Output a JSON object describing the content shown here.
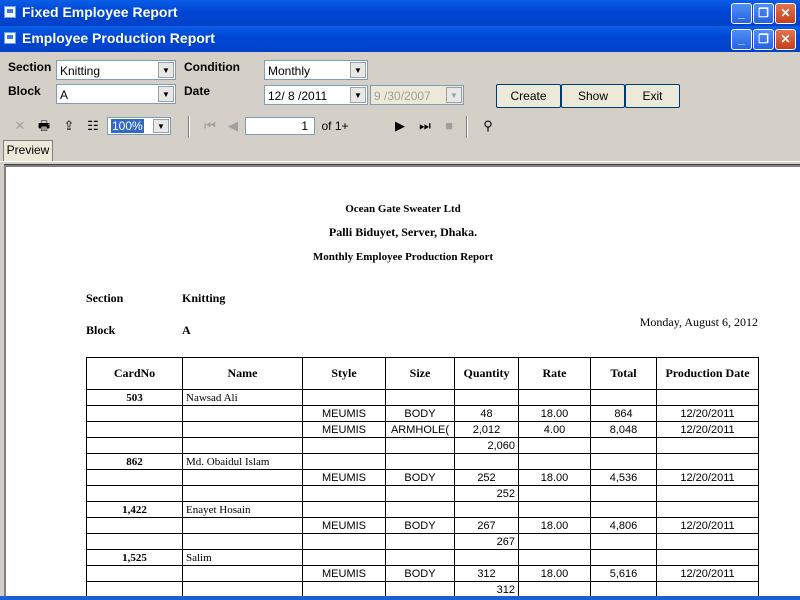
{
  "outer_window": {
    "title": "Fixed Employee Report"
  },
  "inner_window": {
    "title": "Employee Production Report"
  },
  "filters": {
    "section_label": "Section",
    "section_value": "Knitting",
    "block_label": "Block",
    "block_value": "A",
    "condition_label": "Condition",
    "condition_value": "Monthly",
    "date_label": "Date",
    "date_from": "12/ 8 /2011",
    "date_to": "9 /30/2007"
  },
  "buttons": {
    "create": "Create",
    "show": "Show",
    "exit": "Exit"
  },
  "toolbar": {
    "zoom": "100%",
    "page_number": "1",
    "page_of": "of 1+",
    "close_icon": "x-icon",
    "print_icon": "printer-icon",
    "export_icon": "export-icon",
    "tree_icon": "group-tree-icon",
    "first_icon": "first-page-icon",
    "prev_icon": "prev-page-icon",
    "next_icon": "next-page-icon",
    "last_icon": "last-page-icon",
    "stop_icon": "stop-icon",
    "search_icon": "binoculars-icon"
  },
  "tabs": {
    "preview": "Preview"
  },
  "report": {
    "company": "Ocean Gate Sweater Ltd",
    "address": "Palli Biduyet, Server, Dhaka.",
    "title": "Monthly Employee Production Report",
    "section_label": "Section",
    "section_value": "Knitting",
    "block_label": "Block",
    "block_value": "A",
    "print_date": "Monday, August 6, 2012",
    "columns": [
      "CardNo",
      "Name",
      "Style",
      "Size",
      "Quantity",
      "Rate",
      "Total",
      "Production Date"
    ],
    "employees": [
      {
        "card": "503",
        "name": "Nawsad Ali",
        "rows": [
          {
            "style": "MEUMIS",
            "size": "BODY",
            "qty": "48",
            "rate": "18.00",
            "total": "864",
            "date": "12/20/2011"
          },
          {
            "style": "MEUMIS",
            "size": "ARMHOLE(",
            "qty": "2,012",
            "rate": "4.00",
            "total": "8,048",
            "date": "12/20/2011"
          }
        ],
        "subtotal": "2,060"
      },
      {
        "card": "862",
        "name": "Md. Obaidul Islam",
        "rows": [
          {
            "style": "MEUMIS",
            "size": "BODY",
            "qty": "252",
            "rate": "18.00",
            "total": "4,536",
            "date": "12/20/2011"
          }
        ],
        "subtotal": "252"
      },
      {
        "card": "1,422",
        "name": "Enayet Hosain",
        "rows": [
          {
            "style": "MEUMIS",
            "size": "BODY",
            "qty": "267",
            "rate": "18.00",
            "total": "4,806",
            "date": "12/20/2011"
          }
        ],
        "subtotal": "267"
      },
      {
        "card": "1,525",
        "name": "Salim",
        "rows": [
          {
            "style": "MEUMIS",
            "size": "BODY",
            "qty": "312",
            "rate": "18.00",
            "total": "5,616",
            "date": "12/20/2011"
          }
        ],
        "subtotal": "312"
      }
    ]
  },
  "colors": {
    "title_bar": "#0047d6",
    "window_bg": "#d4d0c8",
    "close_button": "#c4401c"
  }
}
